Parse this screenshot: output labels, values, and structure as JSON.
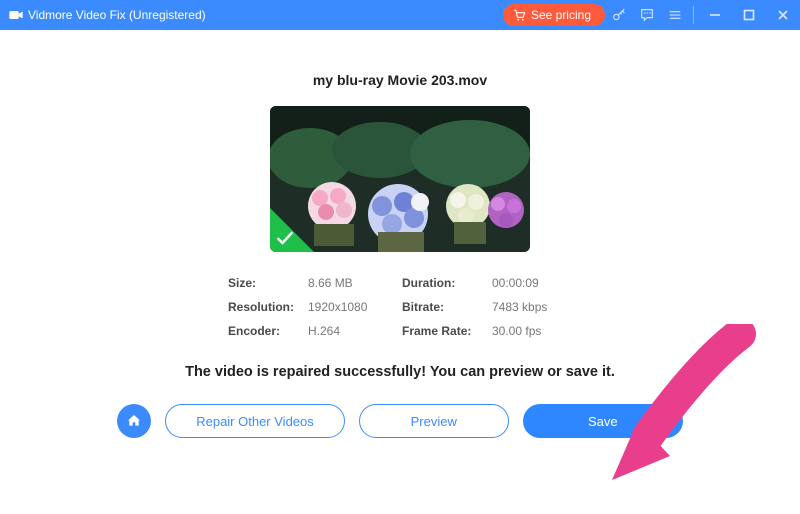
{
  "titlebar": {
    "app_title": "Vidmore Video Fix (Unregistered)",
    "see_pricing": "See pricing"
  },
  "file": {
    "name": "my blu-ray Movie 203.mov"
  },
  "info": {
    "labels": {
      "size": "Size:",
      "duration": "Duration:",
      "resolution": "Resolution:",
      "bitrate": "Bitrate:",
      "encoder": "Encoder:",
      "frame_rate": "Frame Rate:"
    },
    "values": {
      "size": "8.66 MB",
      "duration": "00:00:09",
      "resolution": "1920x1080",
      "bitrate": "7483 kbps",
      "encoder": "H.264",
      "frame_rate": "30.00 fps"
    }
  },
  "messages": {
    "success": "The video is repaired successfully! You can preview or save it."
  },
  "buttons": {
    "repair_other": "Repair Other Videos",
    "preview": "Preview",
    "save": "Save"
  }
}
